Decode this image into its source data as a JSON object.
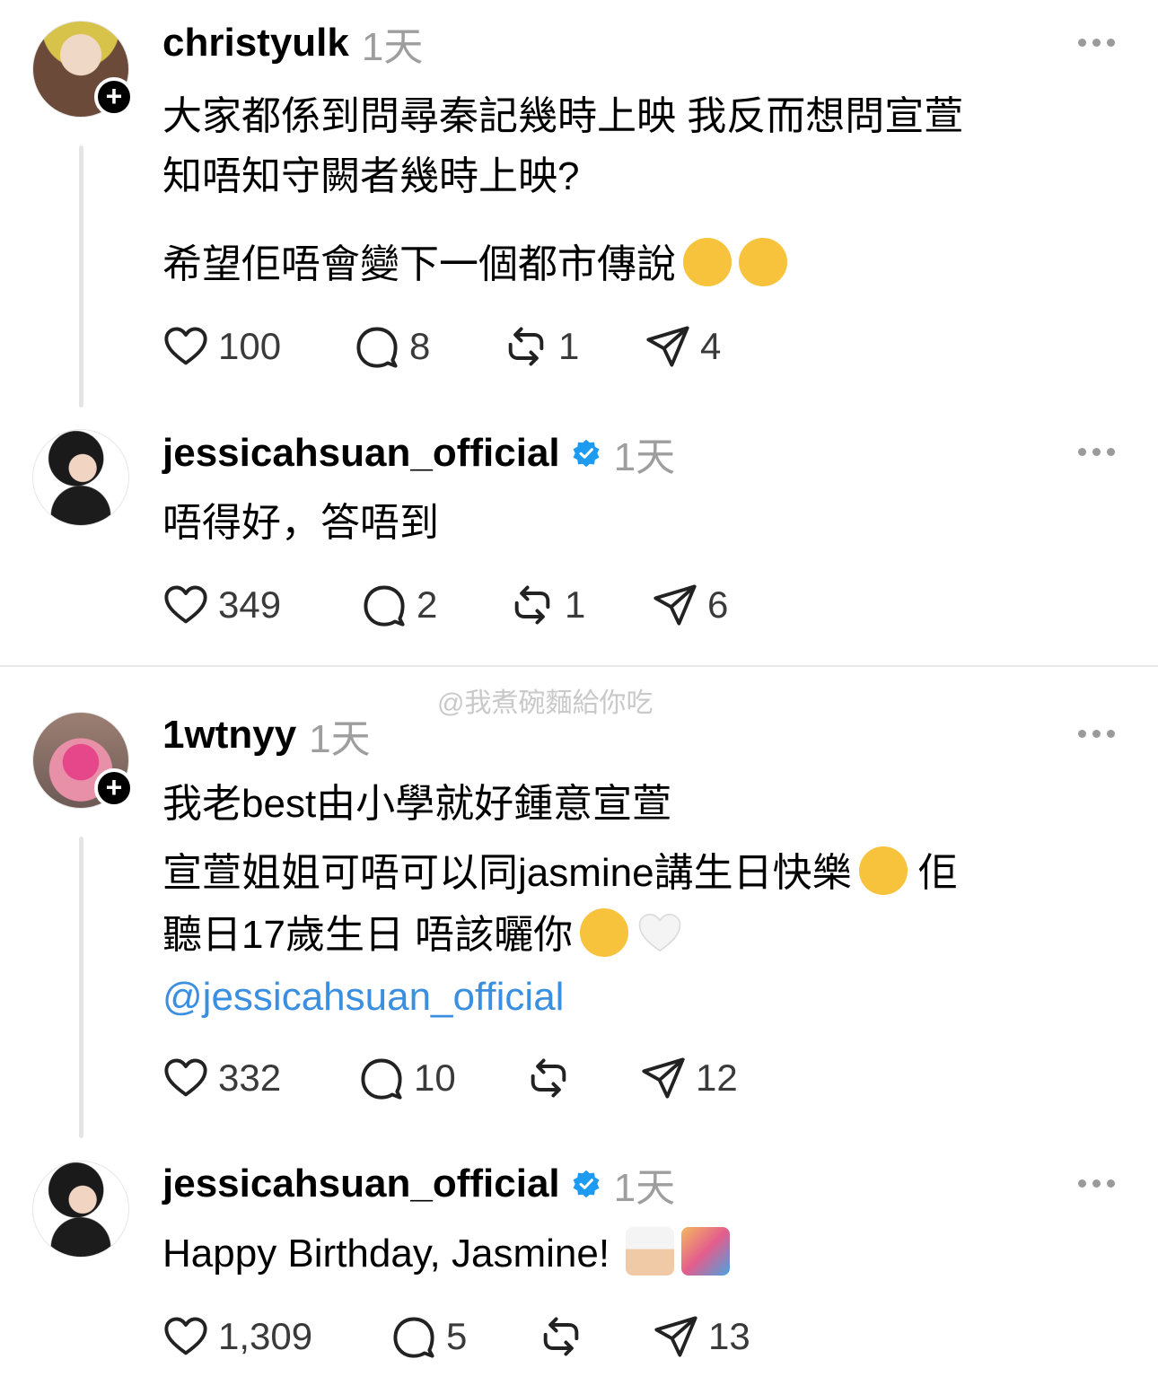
{
  "watermark": "@我煮碗麵給你吃",
  "posts": [
    {
      "username": "christyulk",
      "time": "1天",
      "avatar": "knitted-doll-avatar",
      "follow": "+",
      "lines": [
        "大家都係到問尋秦記幾時上映 我反而想問宣萱",
        "知唔知守闕者幾時上映?",
        "希望佢唔會變下一個都市傳說"
      ],
      "emojis": [
        "relieved-face",
        "relieved-face"
      ],
      "likes": "100",
      "comments": "8",
      "reposts": "1",
      "shares": "4"
    },
    {
      "username": "jessicahsuan_official",
      "verified": true,
      "time": "1天",
      "avatar": "woman-portrait-avatar",
      "lines": [
        "唔得好，答唔到"
      ],
      "likes": "349",
      "comments": "2",
      "reposts": "1",
      "shares": "6"
    },
    {
      "username": "1wtnyy",
      "time": "1天",
      "avatar": "cartoon-avatar",
      "follow": "+",
      "lines": [
        "我老best由小學就好鍾意宣萱",
        "宣萱姐姐可唔可以同jasmine講生日快樂",
        " 佢",
        "聽日17歲生日 唔該曬你"
      ],
      "mention": "@jessicahsuan_official",
      "emojis": [
        "crying-face",
        "crying-face",
        "white-heart"
      ],
      "likes": "332",
      "comments": "10",
      "reposts": "",
      "shares": "12"
    },
    {
      "username": "jessicahsuan_official",
      "verified": true,
      "time": "1天",
      "avatar": "woman-portrait-avatar",
      "lines": [
        "Happy Birthday, Jasmine!"
      ],
      "emojis": [
        "birthday-cake",
        "confetti-ball"
      ],
      "likes": "1,309",
      "comments": "5",
      "reposts": "",
      "shares": "13"
    }
  ],
  "colors": {
    "verified": "#1d9bf0",
    "mention": "#3a8fe0",
    "muted": "#9e9e9e"
  }
}
